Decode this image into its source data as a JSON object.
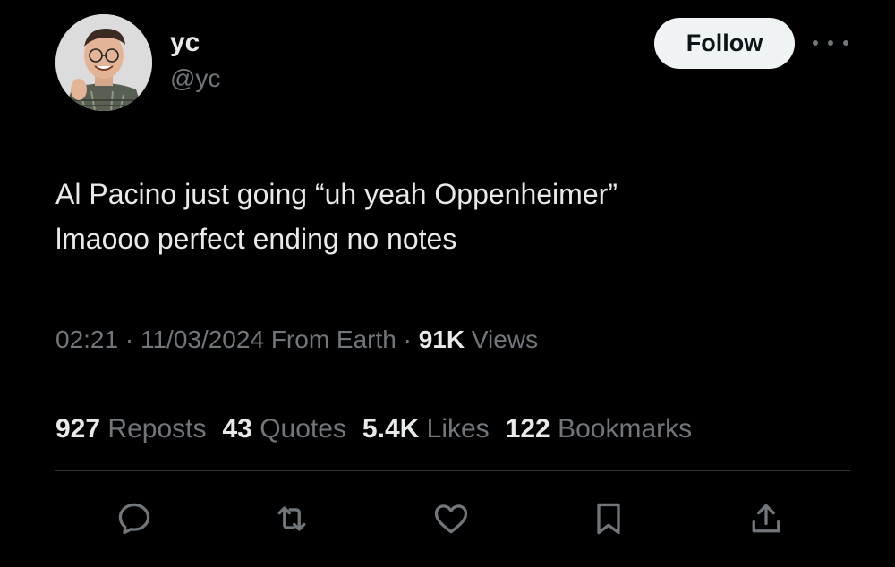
{
  "author": {
    "display_name": "yc",
    "handle": "@yc"
  },
  "follow_button": {
    "label": "Follow"
  },
  "more_button": {
    "icon": "more-horizontal-icon"
  },
  "tweet": {
    "lines": [
      "Al Pacino just going “uh yeah Oppenheimer”",
      "lmaooo perfect ending no notes"
    ]
  },
  "meta": {
    "time": "02:21",
    "separator": "·",
    "date": "11/03/2024",
    "source": "From Earth",
    "views_count": "91K",
    "views_label": "Views"
  },
  "stats": {
    "reposts": {
      "count": "927",
      "label": "Reposts"
    },
    "quotes": {
      "count": "43",
      "label": "Quotes"
    },
    "likes": {
      "count": "5.4K",
      "label": "Likes"
    },
    "bookmarks": {
      "count": "122",
      "label": "Bookmarks"
    }
  },
  "actions": [
    {
      "icon": "reply-icon"
    },
    {
      "icon": "repost-icon"
    },
    {
      "icon": "like-icon"
    },
    {
      "icon": "bookmark-icon"
    },
    {
      "icon": "share-icon"
    }
  ],
  "colors": {
    "background": "#000000",
    "primary_text": "#e7e9ea",
    "secondary_text": "#71767b",
    "divider": "#2f3336",
    "follow_bg": "#eff3f4"
  }
}
